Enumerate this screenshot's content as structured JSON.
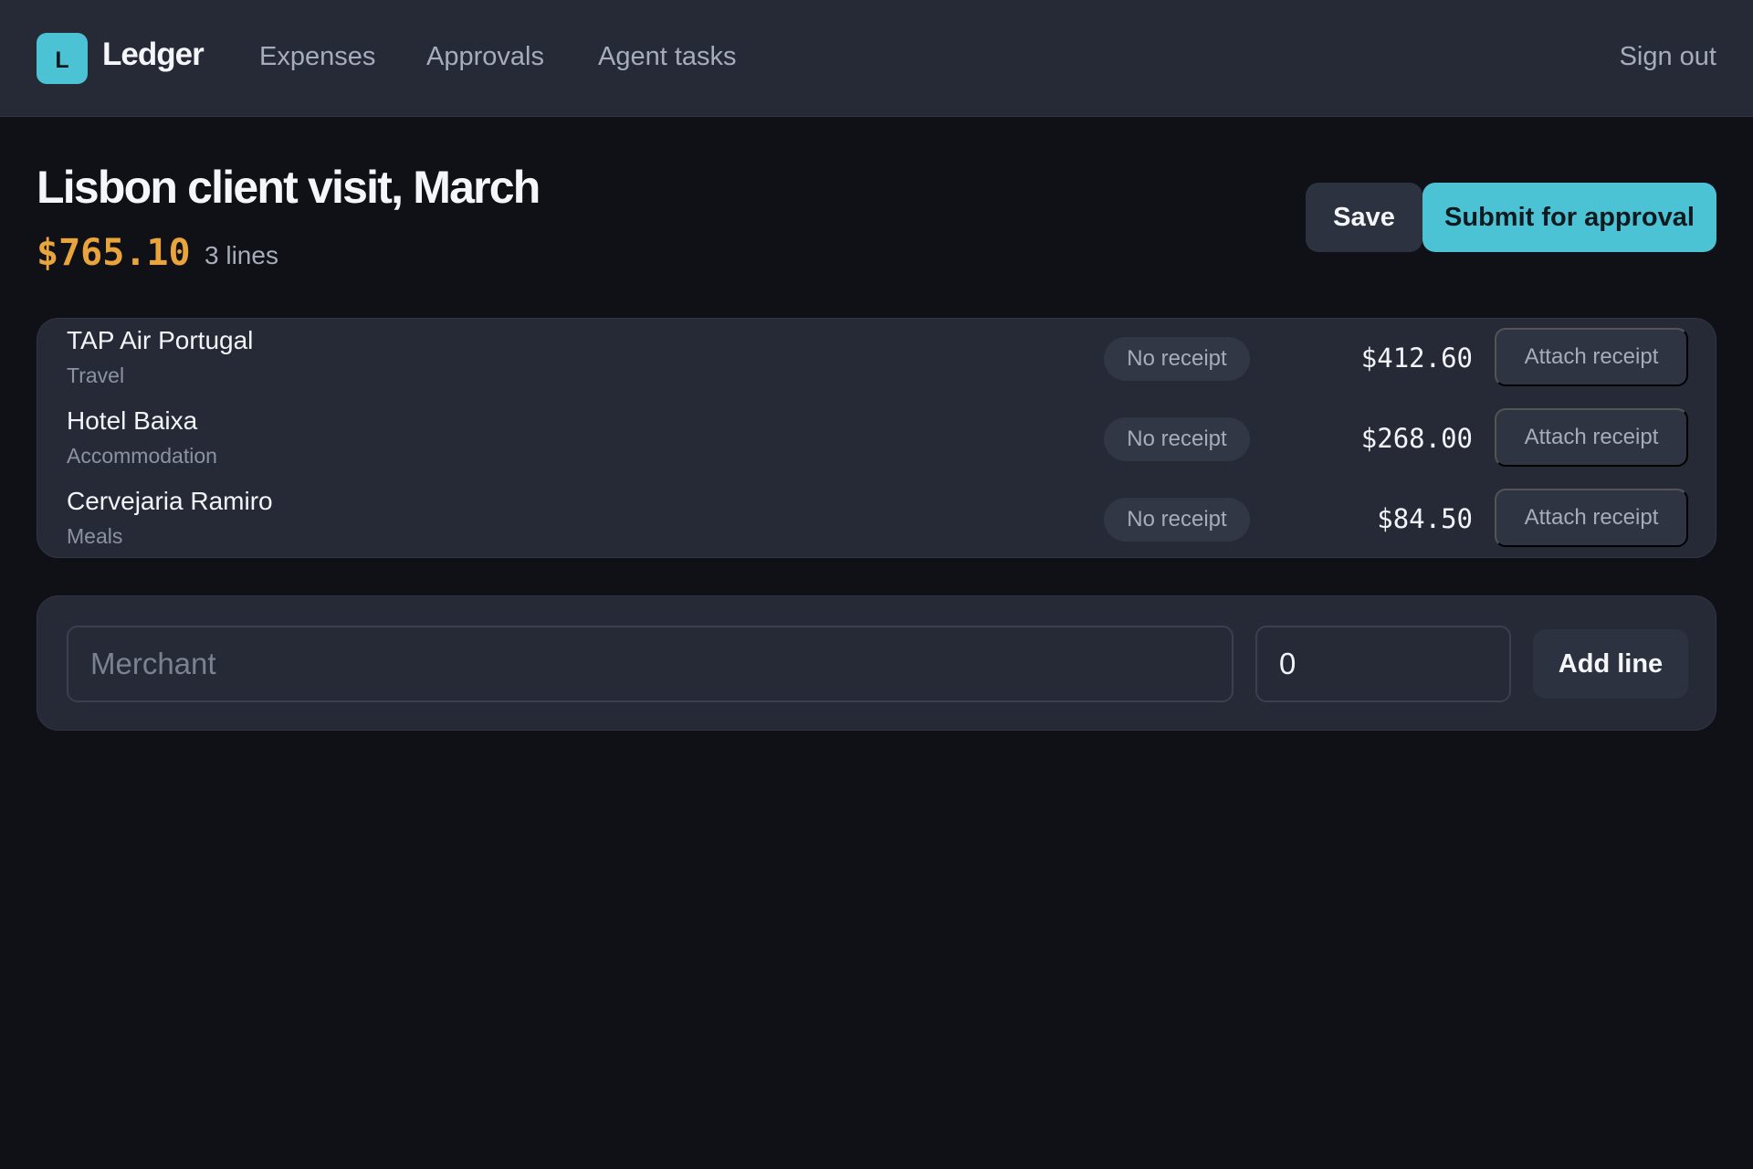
{
  "app": {
    "logo_letter": "L",
    "name": "Ledger"
  },
  "nav": {
    "items": [
      {
        "label": "Expenses"
      },
      {
        "label": "Approvals"
      },
      {
        "label": "Agent tasks"
      }
    ],
    "sign_out": "Sign out"
  },
  "report": {
    "title": "Lisbon client visit, March",
    "total": "$765.10",
    "line_count": "3 lines",
    "save_label": "Save",
    "submit_label": "Submit for approval"
  },
  "lines": [
    {
      "merchant": "TAP Air Portugal",
      "category": "Travel",
      "receipt_status": "No receipt",
      "amount": "$412.60",
      "attach_label": "Attach receipt"
    },
    {
      "merchant": "Hotel Baixa",
      "category": "Accommodation",
      "receipt_status": "No receipt",
      "amount": "$268.00",
      "attach_label": "Attach receipt"
    },
    {
      "merchant": "Cervejaria Ramiro",
      "category": "Meals",
      "receipt_status": "No receipt",
      "amount": "$84.50",
      "attach_label": "Attach receipt"
    }
  ],
  "add_form": {
    "merchant_placeholder": "Merchant",
    "merchant_value": "",
    "amount_value": "0",
    "add_label": "Add line"
  },
  "colors": {
    "accent": "#4cc3d4",
    "total": "#e9a43c",
    "background": "#101116",
    "surface": "#262a36"
  }
}
